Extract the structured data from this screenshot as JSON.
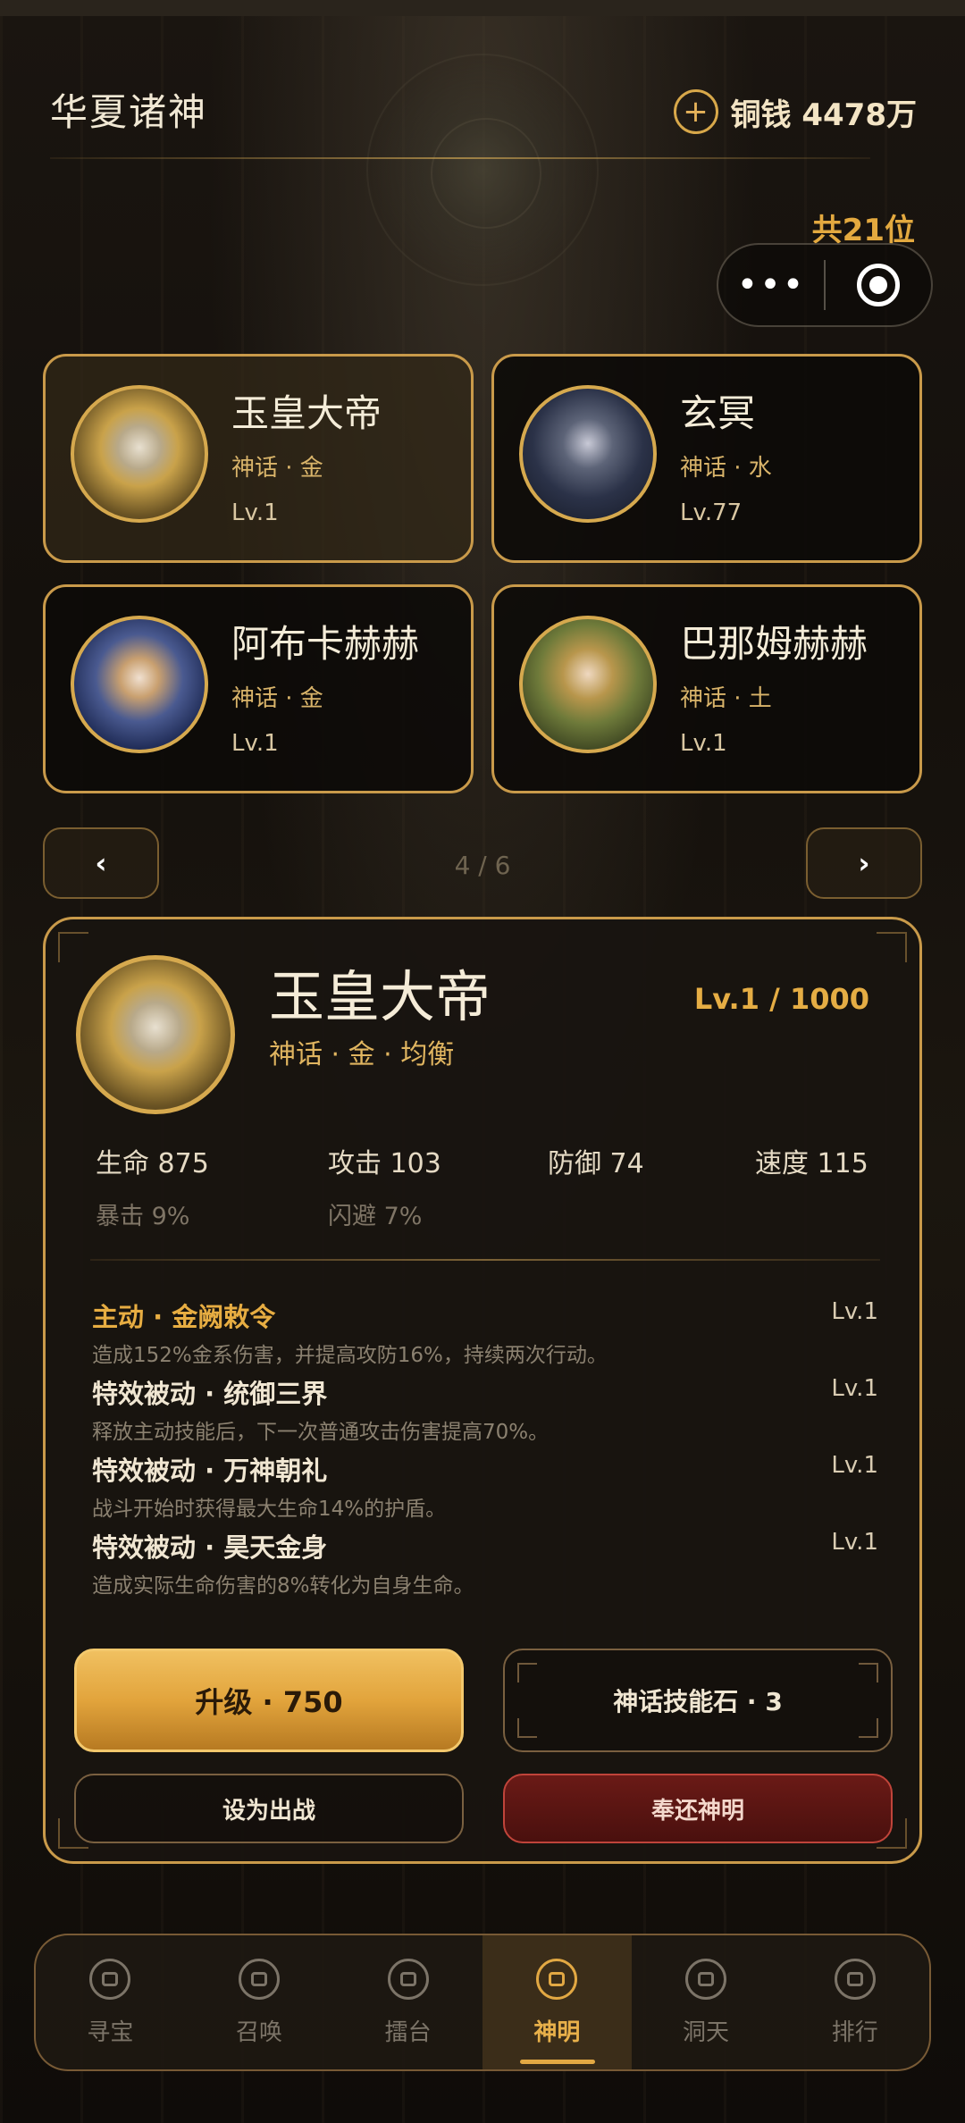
{
  "header": {
    "title": "华夏诸神",
    "currency_icon": "plus-circle-icon",
    "currency_text": "铜钱 4478万"
  },
  "total_count": "共21位",
  "capsule": {
    "more_icon": "•••",
    "target_icon": "target-icon"
  },
  "cards": [
    {
      "name": "玉皇大帝",
      "tag": "神话 · 金",
      "level": "Lv.1",
      "selected": true
    },
    {
      "name": "玄冥",
      "tag": "神话 · 水",
      "level": "Lv.77",
      "selected": false
    },
    {
      "name": "阿布卡赫赫",
      "tag": "神话 · 金",
      "level": "Lv.1",
      "selected": false
    },
    {
      "name": "巴那姆赫赫",
      "tag": "神话 · 土",
      "level": "Lv.1",
      "selected": false
    }
  ],
  "pager": {
    "prev": "‹",
    "next": "›",
    "text": "4 / 6"
  },
  "detail": {
    "name": "玉皇大帝",
    "level": "Lv.1 / 1000",
    "tags": "神话 · 金 · 均衡",
    "stats": {
      "hp": "生命 875",
      "atk": "攻击 103",
      "def": "防御 74",
      "spd": "速度 115",
      "crit": "暴击 9%",
      "dodge": "闪避 7%"
    },
    "skills": [
      {
        "title": "主动 · 金阙敕令",
        "level": "Lv.1",
        "desc": "造成152%金系伤害，并提高攻防16%，持续两次行动。"
      },
      {
        "title": "特效被动 · 统御三界",
        "level": "Lv.1",
        "desc": "释放主动技能后，下一次普通攻击伤害提高70%。"
      },
      {
        "title": "特效被动 · 万神朝礼",
        "level": "Lv.1",
        "desc": "战斗开始时获得最大生命14%的护盾。"
      },
      {
        "title": "特效被动 · 昊天金身",
        "level": "Lv.1",
        "desc": "造成实际生命伤害的8%转化为自身生命。"
      }
    ],
    "buttons": {
      "upgrade": "升级 · 750",
      "skill_stone": "神话技能石 · 3",
      "deploy": "设为出战",
      "return": "奉还神明"
    }
  },
  "nav": [
    {
      "label": "寻宝",
      "icon": "treasure-icon",
      "active": false
    },
    {
      "label": "召唤",
      "icon": "summon-icon",
      "active": false
    },
    {
      "label": "擂台",
      "icon": "arena-icon",
      "active": false
    },
    {
      "label": "神明",
      "icon": "deity-icon",
      "active": true
    },
    {
      "label": "洞天",
      "icon": "home-icon",
      "active": false
    },
    {
      "label": "排行",
      "icon": "rank-icon",
      "active": false
    }
  ],
  "colors": {
    "accent_gold": "#e2a843",
    "card_border": "#c99a4a",
    "danger_red": "#c0443a"
  }
}
